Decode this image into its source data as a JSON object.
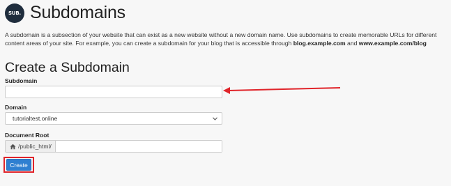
{
  "header": {
    "icon_text": "SUB.",
    "title": "Subdomains"
  },
  "description": {
    "text_1": "A subdomain is a subsection of your website that can exist as a new website without a new domain name. Use subdomains to create memorable URLs for different content areas of your site. For example, you can create a subdomain for your blog that is accessible through ",
    "bold_1": "blog.example.com",
    "text_2": " and ",
    "bold_2": "www.example.com/blog"
  },
  "form": {
    "section_title": "Create a Subdomain",
    "subdomain_label": "Subdomain",
    "subdomain_value": "",
    "domain_label": "Domain",
    "domain_value": "tutorialtest.online",
    "docroot_label": "Document Root",
    "docroot_prefix": "/public_html/",
    "docroot_value": "",
    "create_label": "Create"
  },
  "annotations": {
    "arrow_color": "#e0242a",
    "highlight_color": "#e0242a"
  },
  "colors": {
    "primary_button": "#2e7fd1",
    "background": "#f7f7f7"
  }
}
